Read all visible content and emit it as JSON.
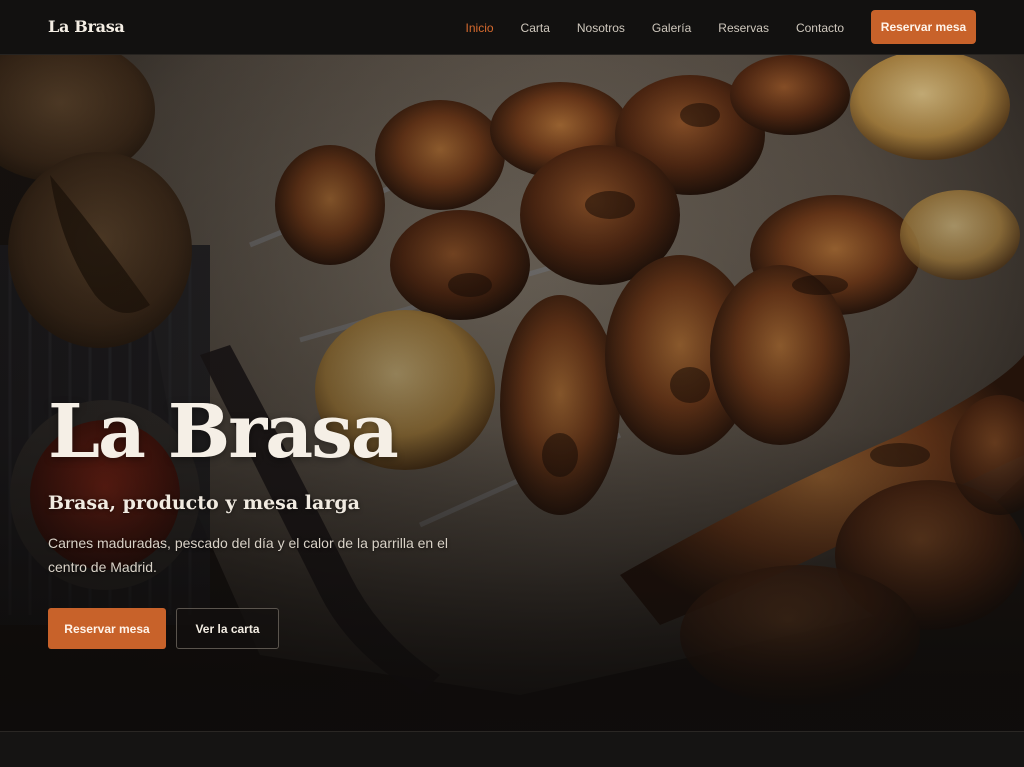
{
  "brand": {
    "name": "La Brasa"
  },
  "nav": {
    "links": [
      {
        "label": "Inicio",
        "active": true
      },
      {
        "label": "Carta",
        "active": false
      },
      {
        "label": "Nosotros",
        "active": false
      },
      {
        "label": "Galería",
        "active": false
      },
      {
        "label": "Reservas",
        "active": false
      },
      {
        "label": "Contacto",
        "active": false
      }
    ],
    "cta_label": "Reservar mesa"
  },
  "hero": {
    "title": "La Brasa",
    "subtitle": "Brasa, producto y mesa larga",
    "description": "Carnes maduradas, pescado del día y el calor de la parrilla en el centro de Madrid.",
    "primary_label": "Reservar mesa",
    "secondary_label": "Ver la carta",
    "image_icon": "grilled-meat-platter-photo"
  },
  "colors": {
    "accent": "#c8622a",
    "nav_active": "#d66a2e",
    "background": "#141414",
    "text": "#f2ece2"
  }
}
